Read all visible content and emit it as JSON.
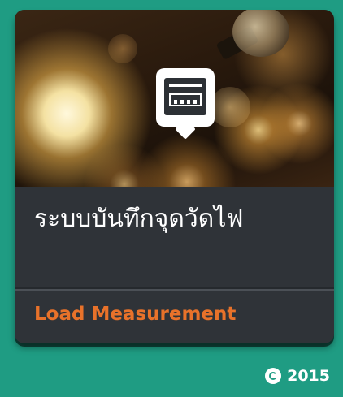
{
  "tile": {
    "title": "ระบบบันทึกจุดวัดไฟ",
    "subtitle": "Load Measurement",
    "icon": "meter-display-icon"
  },
  "footer": {
    "copyright_icon": "copyright-icon",
    "year": "2015"
  },
  "colors": {
    "background": "#1f9c83",
    "card": "#2f3338",
    "subtitle": "#e8722a",
    "text": "#ffffff"
  }
}
